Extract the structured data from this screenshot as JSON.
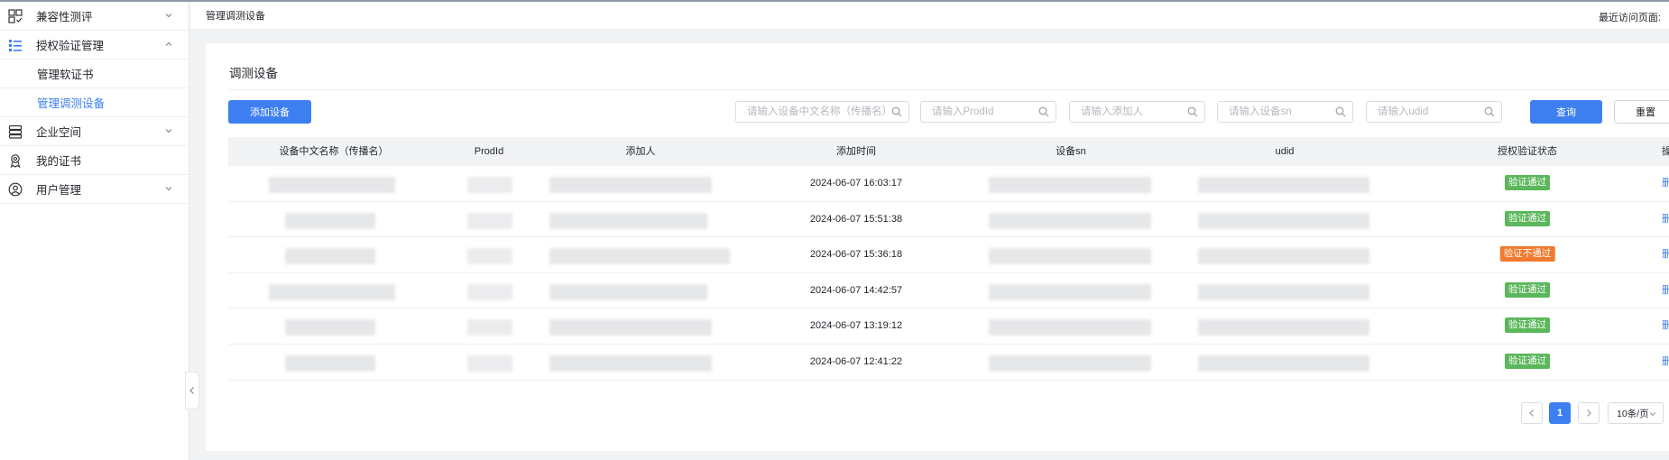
{
  "sidebar": {
    "items": [
      {
        "label": "兼容性测评",
        "icon": "grid-check-icon"
      },
      {
        "label": "授权验证管理",
        "icon": "list-icon"
      },
      {
        "label": "企业空间",
        "icon": "server-icon"
      },
      {
        "label": "我的证书",
        "icon": "certificate-icon"
      },
      {
        "label": "用户管理",
        "icon": "user-icon"
      }
    ],
    "sub_items": [
      {
        "label": "管理软证书"
      },
      {
        "label": "管理调测设备"
      }
    ]
  },
  "header": {
    "breadcrumb": "管理调测设备",
    "recent_label": "最近访问页面:"
  },
  "main": {
    "title": "调测设备",
    "add_button": "添加设备",
    "query_button": "查询",
    "reset_button": "重置",
    "search": {
      "name_placeholder": "请输入设备中文名称（传播名）",
      "prodid_placeholder": "请输入ProdId",
      "adder_placeholder": "请输入添加人",
      "sn_placeholder": "请输入设备sn",
      "udid_placeholder": "请输入udid"
    },
    "table": {
      "headers": [
        "设备中文名称（传播名）",
        "ProdId",
        "添加人",
        "添加时间",
        "设备sn",
        "udid",
        "授权验证状态",
        "操作"
      ],
      "rows": [
        {
          "time": "2024-06-07 16:03:17",
          "status": "验证通过",
          "status_type": "pass",
          "action": "删除"
        },
        {
          "time": "2024-06-07 15:51:38",
          "status": "验证通过",
          "status_type": "pass",
          "action": "删除"
        },
        {
          "time": "2024-06-07 15:36:18",
          "status": "验证不通过",
          "status_type": "fail",
          "action": "删除"
        },
        {
          "time": "2024-06-07 14:42:57",
          "status": "验证通过",
          "status_type": "pass",
          "action": "删除"
        },
        {
          "time": "2024-06-07 13:19:12",
          "status": "验证通过",
          "status_type": "pass",
          "action": "删除"
        },
        {
          "time": "2024-06-07 12:41:22",
          "status": "验证通过",
          "status_type": "pass",
          "action": "删除"
        }
      ]
    },
    "pagination": {
      "current_page": "1",
      "page_size": "10条/页"
    }
  },
  "colors": {
    "primary": "#3d7ff0",
    "pass": "#5bb75b",
    "fail": "#f07a2e"
  }
}
